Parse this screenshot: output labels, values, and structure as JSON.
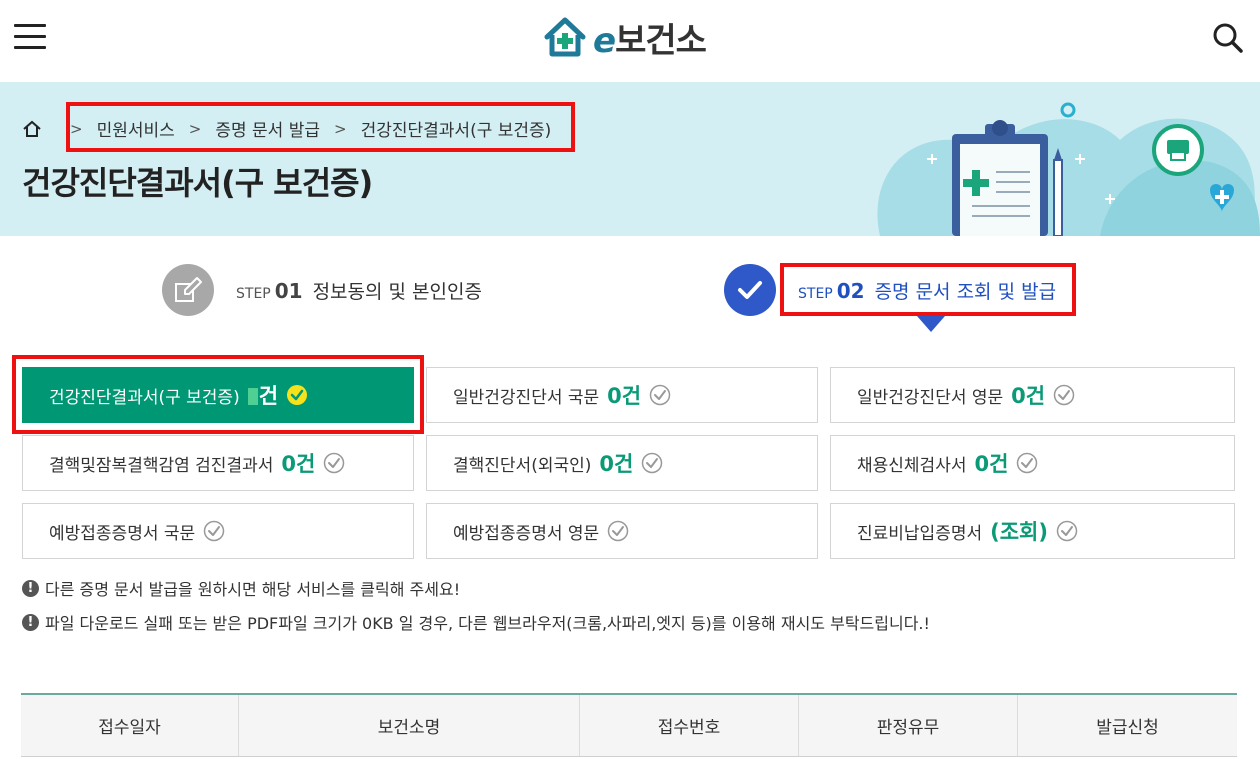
{
  "header": {
    "menu_icon": "hamburger-icon",
    "logo_e": "e",
    "logo_text": "보건소",
    "search_icon": "search-icon"
  },
  "breadcrumb": {
    "home_icon": "home-icon",
    "items": [
      "민원서비스",
      "증명 문서 발급",
      "건강진단결과서(구 보건증)"
    ]
  },
  "page_title": "건강진단결과서(구 보건증)",
  "steps": [
    {
      "word": "STEP",
      "num": "01",
      "desc": "정보동의 및 본인인증",
      "icon": "pencil-icon"
    },
    {
      "word": "STEP",
      "num": "02",
      "desc": "증명 문서 조회 및 발급",
      "icon": "check-icon"
    }
  ],
  "documents": [
    {
      "label": "건강진단결과서(구 보건증)",
      "count": "건",
      "active": true
    },
    {
      "label": "일반건강진단서 국문",
      "count": "0건"
    },
    {
      "label": "일반건강진단서 영문",
      "count": "0건"
    },
    {
      "label": "결핵및잠복결핵감염 검진결과서",
      "count": "0건"
    },
    {
      "label": "결핵진단서(외국인)",
      "count": "0건"
    },
    {
      "label": "채용신체검사서",
      "count": "0건"
    },
    {
      "label": "예방접종증명서 국문",
      "count": ""
    },
    {
      "label": "예방접종증명서 영문",
      "count": ""
    },
    {
      "label": "진료비납입증명서",
      "count": "(조회)"
    }
  ],
  "notes": [
    "다른 증명 문서 발급을 원하시면 해당 서비스를 클릭해 주세요!",
    "파일 다운로드 실패 또는 받은 PDF파일 크기가 0KB 일 경우, 다른 웹브라우저(크롬,사파리,엣지 등)를 이용해 재시도 부탁드립니다.!"
  ],
  "table": {
    "headers": [
      "접수일자",
      "보건소명",
      "접수번호",
      "판정유무",
      "발급신청"
    ]
  },
  "colors": {
    "banner_bg": "#d3eff3",
    "active_green": "#009874",
    "count_green": "#0b9a78",
    "step_blue": "#2f58c8",
    "highlight_red": "#ee1111"
  }
}
